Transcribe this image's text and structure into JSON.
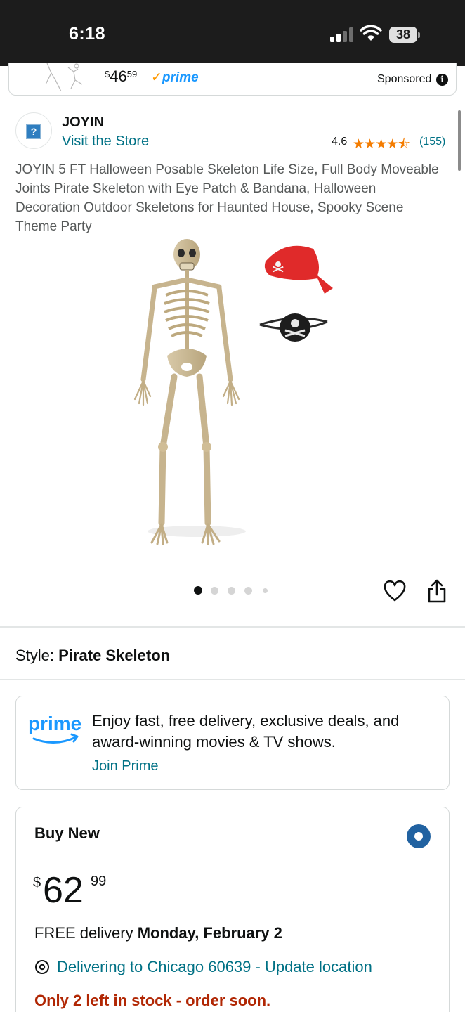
{
  "status_bar": {
    "time": "6:18",
    "battery": "38"
  },
  "sponsored_ad": {
    "price_whole": "46",
    "price_fraction": "59",
    "currency": "$",
    "prime_label": "prime",
    "sponsored_label": "Sponsored"
  },
  "store": {
    "brand": "JOYIN",
    "visit_label": "Visit the Store",
    "rating": "4.6",
    "stars": "★★★★⯪",
    "rating_count": "(155)"
  },
  "product": {
    "title": "JOYIN 5 FT Halloween Posable Skeleton Life Size, Full Body Moveable Joints Pirate Skeleton with Eye Patch & Bandana, Halloween Decoration Outdoor Skeletons for Haunted House, Spooky Scene Theme Party",
    "image_count": 5,
    "active_image": 1
  },
  "style": {
    "label": "Style:",
    "value": "Pirate Skeleton"
  },
  "prime_promo": {
    "logo": "prime",
    "text": "Enjoy fast, free delivery, exclusive deals, and award-winning movies & TV shows.",
    "link": "Join Prime"
  },
  "buy_box": {
    "title": "Buy New",
    "currency": "$",
    "price_whole": "62",
    "price_fraction": "99",
    "delivery_prefix": "FREE delivery",
    "delivery_date": "Monday, February 2",
    "location": "Delivering to Chicago 60639 - Update location",
    "stock": "Only 2 left in stock - order soon."
  },
  "colors": {
    "link": "#007185",
    "star": "#f47c00",
    "stock_warning": "#b12704",
    "radio_selected": "#2162a1",
    "prime_blue": "#1a98ff"
  },
  "icons": [
    "signal-icon",
    "wifi-icon",
    "battery-icon",
    "info-icon",
    "heart-icon",
    "share-icon",
    "location-pin-icon",
    "prime-logo-icon",
    "store-logo-icon"
  ]
}
